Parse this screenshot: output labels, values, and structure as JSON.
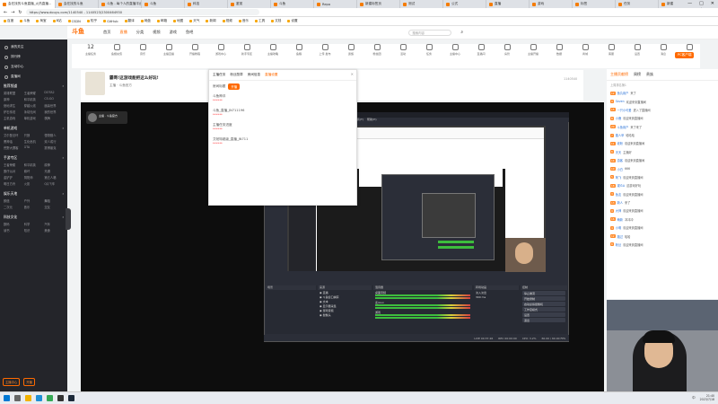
{
  "browser": {
    "tabs": [
      "会在找的斗鱼",
      "斗鱼 - 每个人的直播平台",
      "斗鱼",
      "科技",
      "鉴赏",
      "斗鱼",
      "Repo",
      "新建标签页",
      "测试",
      "公式",
      "直播",
      "游戏",
      "标签",
      "任务",
      "新建"
    ],
    "active_tab": "会在找的斗鱼直播_火热直播...",
    "url": "https://www.douyu.com/1140540 - 1140523/2300464930",
    "window_controls": [
      "—",
      "□",
      "✕"
    ]
  },
  "bookmarks": [
    "百度",
    "斗鱼",
    "淘宝",
    "B站",
    "CSDN",
    "知乎",
    "GitHub",
    "翻译",
    "网盘",
    "邮箱",
    "地图",
    "天气",
    "新闻",
    "视频",
    "音乐",
    "工具",
    "文档",
    "设置"
  ],
  "header": {
    "logo": "斗鱼",
    "nav": [
      "首页",
      "直播",
      "分类",
      "视频",
      "游戏",
      "鱼吧"
    ],
    "active_nav": "直播",
    "search_placeholder": "搜索内容"
  },
  "categories": [
    {
      "num": "12",
      "label": "主播任务"
    },
    {
      "label": "鱼翅充值"
    },
    {
      "label": "音乐"
    },
    {
      "label": "主播直播"
    },
    {
      "label": "开播教程"
    },
    {
      "label": "游戏中心"
    },
    {
      "label": "新手专区"
    },
    {
      "label": "主播攻略"
    },
    {
      "label": "鱼粮"
    },
    {
      "label": "上传·发布"
    },
    {
      "label": "贵族"
    },
    {
      "label": "粉丝团"
    },
    {
      "label": "活动"
    },
    {
      "label": "任务"
    },
    {
      "label": "主播中心"
    },
    {
      "label": "直播间"
    },
    {
      "label": "房管"
    },
    {
      "label": "主播开播"
    },
    {
      "label": "数据"
    },
    {
      "label": "商城"
    },
    {
      "label": "客服"
    },
    {
      "label": "设置"
    },
    {
      "label": "消息"
    },
    {
      "label": "更多"
    }
  ],
  "pc_label": "PC客户端",
  "room": {
    "title": "霸哥!这游戏能把这么好玩!",
    "anchor": "主播 · 斗鱼官方",
    "follow": "关注",
    "id": "1140540"
  },
  "popup": {
    "tabs": [
      "主播任务",
      "粉丝勋章",
      "房间信息",
      "直播设置"
    ],
    "active": "直播设置",
    "rows": [
      {
        "label": "房间标题",
        "value": "未设置"
      },
      {
        "label": "斗鱼神评",
        "value": "******"
      },
      {
        "label": "斗鱼_直播_JN711196",
        "value": "******"
      },
      {
        "label": "主播任务进度",
        "value": "******"
      },
      {
        "label": "艾帕特超级_直播_JN711",
        "value": "******"
      }
    ],
    "button": "开播",
    "close": "✕"
  },
  "sidebar": {
    "nav": [
      "我的关注",
      "排行榜",
      "互动中心",
      "直播间"
    ],
    "sections": [
      {
        "title": "推荐频道",
        "items": [
          "英雄联盟",
          "王者荣耀",
          "DOTA2",
          "原神",
          "和平精英",
          "CS:GO",
          "绝地求生",
          "穿越火线",
          "魔兽世界",
          "炉石传说",
          "永劫无间",
          "我的世界",
          "主机游戏",
          "单机游戏",
          "棋牌"
        ]
      },
      {
        "title": "单机游戏",
        "items": [
          "艾尔登法环",
          "只狼",
          "怪物猎人",
          "黑神话",
          "生化危机",
          "双人成行",
          "荒野大镖客",
          "GTA",
          "赛博朋克"
        ]
      },
      {
        "title": "手游专区",
        "items": [
          "王者荣耀",
          "和平精英",
          "原神",
          "蛋仔派对",
          "崩坏",
          "光遇",
          "金铲铲",
          "阴阳师",
          "第五人格",
          "明日方舟",
          "火影",
          "QQ飞车"
        ]
      },
      {
        "title": "娱乐天地",
        "items": [
          "颜值",
          "户外",
          "舞蹈",
          "二次元",
          "音乐",
          "交友"
        ]
      },
      {
        "title": "科技文化",
        "items": [
          "数码",
          "科学",
          "汽车",
          "读书",
          "知识",
          "美食"
        ]
      }
    ],
    "bottom_buttons": [
      "主播中心",
      "开播"
    ]
  },
  "obs": {
    "title": "OBS 29.1.3 (64-bit, windows) - 配置文件: 未命名 - 场景: 未命名",
    "menu": [
      "文件(F)",
      "编辑(E)",
      "视图(V)",
      "停靠(D)",
      "配置文件(P)",
      "场景集合(S)",
      "工具(T)",
      "帮助(H)"
    ],
    "docks": {
      "scenes": "场景",
      "sources": "来源",
      "mixer": "混音器",
      "transitions": "转场动画",
      "controls": "控制"
    },
    "sources": [
      "直播",
      "斗鱼窗口捕获",
      "文本",
      "显示器采集",
      "游戏音频",
      "摄像头"
    ],
    "mixer": [
      "桌面音频",
      "麦/Aux",
      "游戏"
    ],
    "controls": [
      "停止推流",
      "开始录制",
      "启动虚拟摄像机",
      "工作室模式",
      "设置",
      "退出"
    ],
    "transition": "淡入淡出",
    "duration": "300 ms",
    "status": [
      "LIVE 00:37:26",
      "REC 00:00:00",
      "CPU: 3.2%",
      "60.00 / 60.00 FPS"
    ]
  },
  "right_panel": {
    "tabs": [
      "主播贡献榜",
      "周榜",
      "贵族"
    ],
    "active": "主播贡献榜",
    "rank_label": "上周排名第1",
    "chat": [
      {
        "badge": "12",
        "user": "鱼丸用户",
        "text": "来了"
      },
      {
        "badge": "9",
        "user": "Seven",
        "text": "欢迎来到直播间"
      },
      {
        "badge": "15",
        "user": "一只小可爱",
        "text": "进入了直播间"
      },
      {
        "badge": "8",
        "user": "小鹿",
        "text": "欢迎来到直播间"
      },
      {
        "badge": "20",
        "user": "斗鱼用户",
        "text": "来了来了"
      },
      {
        "badge": "7",
        "user": "路人甲",
        "text": "哈哈哈"
      },
      {
        "badge": "11",
        "user": "老粉",
        "text": "欢迎来到直播间"
      },
      {
        "badge": "6",
        "user": "天天",
        "text": "主播好"
      },
      {
        "badge": "14",
        "user": "游客",
        "text": "欢迎来到直播间"
      },
      {
        "badge": "10",
        "user": "小白",
        "text": "666"
      },
      {
        "badge": "5",
        "user": "阿飞",
        "text": "欢迎来到直播间"
      },
      {
        "badge": "18",
        "user": "观众A",
        "text": "这游戏好玩"
      },
      {
        "badge": "3",
        "user": "鱼友",
        "text": "欢迎来到直播间"
      },
      {
        "badge": "13",
        "user": "新人",
        "text": "来了"
      },
      {
        "badge": "9",
        "user": "大神",
        "text": "欢迎来到直播间"
      },
      {
        "badge": "16",
        "user": "萌新",
        "text": "冲冲冲"
      },
      {
        "badge": "4",
        "user": "小明",
        "text": "欢迎来到直播间"
      },
      {
        "badge": "12",
        "user": "路过",
        "text": "哈哈"
      },
      {
        "badge": "8",
        "user": "粉丝",
        "text": "欢迎来到直播间"
      }
    ]
  },
  "taskbar": {
    "time": "21:40",
    "date": "2023/7/18",
    "lang": "中",
    "icons": [
      "start",
      "search",
      "files",
      "edge",
      "chrome",
      "obs",
      "steam"
    ]
  },
  "colors": {
    "brand": "#ff6a00",
    "sidebar_bg": "#24252a",
    "video_bg": "#0d0d0d"
  }
}
